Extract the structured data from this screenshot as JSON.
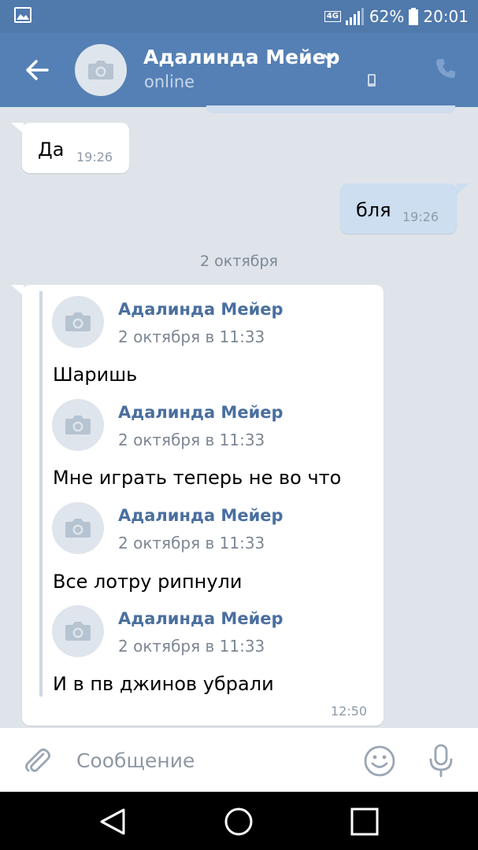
{
  "statusbar": {
    "network": "4G",
    "battery": "62%",
    "time": "20:01"
  },
  "header": {
    "contact_name": "Адалинда Мейер",
    "status": "online"
  },
  "messages": [
    {
      "direction": "in",
      "text": "Да",
      "time": "19:26"
    },
    {
      "direction": "out",
      "text": "бля",
      "time": "19:26"
    }
  ],
  "date_separator": "2 октября",
  "forwarded": {
    "time": "12:50",
    "items": [
      {
        "author": "Адалинда Мейер",
        "date": "2 октября в 11:33",
        "text": "Шаришь"
      },
      {
        "author": "Адалинда Мейер",
        "date": "2 октября в 11:33",
        "text": "Мне играть теперь не во что"
      },
      {
        "author": "Адалинда Мейер",
        "date": "2 октября в 11:33",
        "text": "Все лотру рипнули"
      },
      {
        "author": "Адалинда Мейер",
        "date": "2 октября в 11:33",
        "text": "И в пв джинов убрали"
      }
    ]
  },
  "composer": {
    "placeholder": "Сообщение",
    "value": ""
  },
  "colors": {
    "header": "#5580b5",
    "background": "#dfe4ea",
    "outgoing_bubble": "#ccdef0",
    "incoming_bubble": "#ffffff",
    "author_name": "#4a6fa0"
  }
}
